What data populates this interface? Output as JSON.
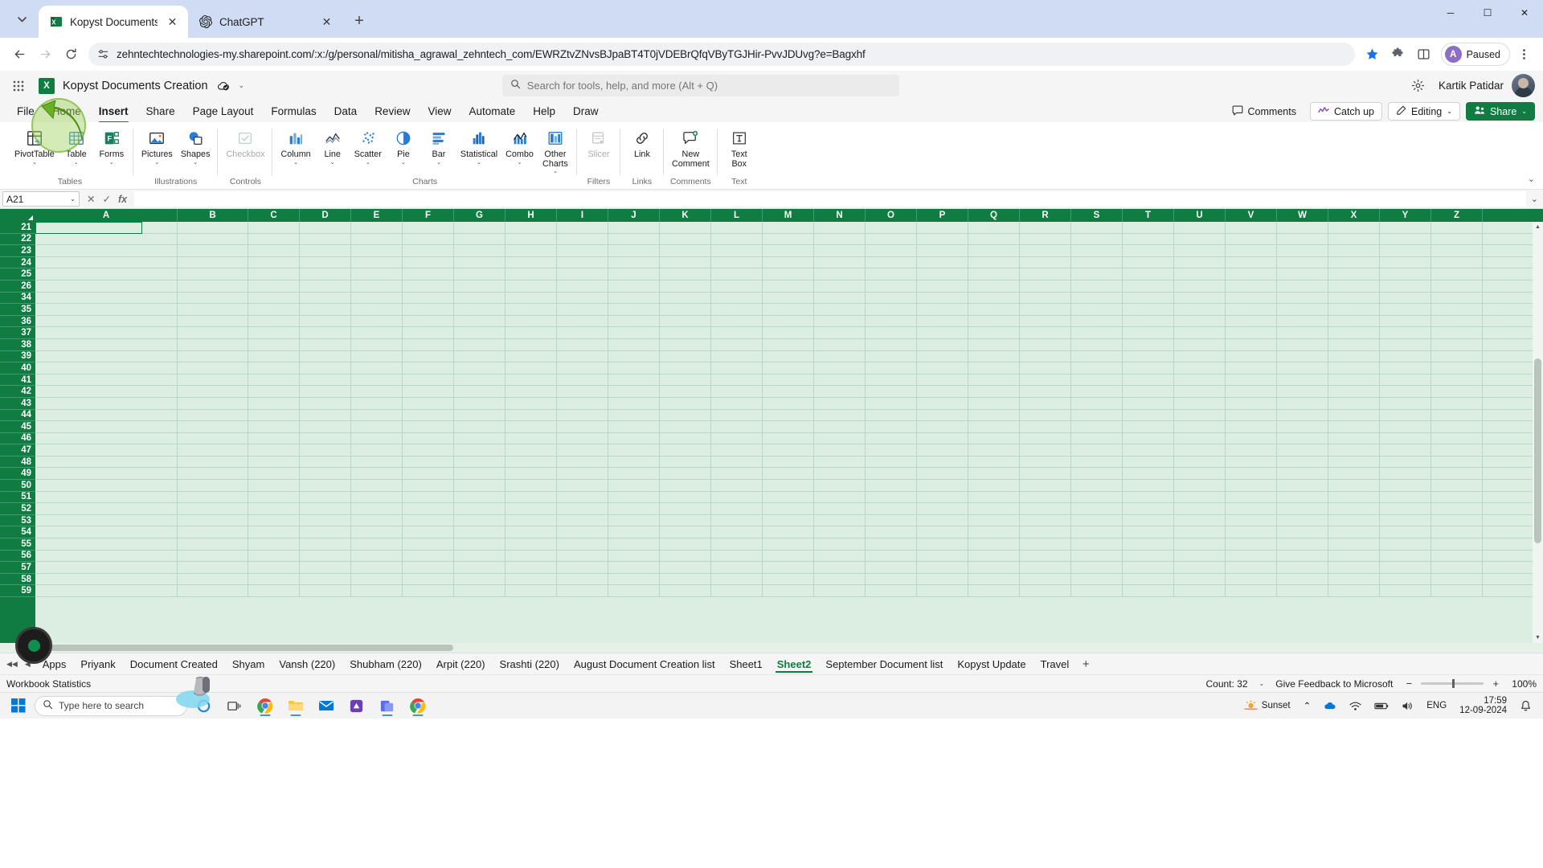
{
  "browser": {
    "tabs": [
      {
        "title": "Kopyst Documents Creation.xlsx",
        "favicon": "excel-icon",
        "active": true
      },
      {
        "title": "ChatGPT",
        "favicon": "chatgpt-icon",
        "active": false
      }
    ],
    "new_tab_label": "+",
    "tab_search_label": "⌄",
    "nav": {
      "back": "←",
      "forward": "→",
      "reload": "↻"
    },
    "url": "zehntechtechnologies-my.sharepoint.com/:x:/g/personal/mitisha_agrawal_zehntech_com/EWRZtvZNvsBJpaBT4T0jVDEBrQfqVByTGJHir-PvvJDUvg?e=Bagxhf",
    "site_info_icon": "tune-icon",
    "bookmark_icon": "star-filled-icon",
    "extensions_icon": "puzzle-icon",
    "split_icon": "split-screen-icon",
    "profile": {
      "initial": "A",
      "label": "Paused"
    },
    "menu_icon": "three-dots-vertical-icon",
    "window_controls": {
      "minimize": "─",
      "maximize": "☐",
      "close": "✕"
    }
  },
  "excel": {
    "waffle_icon": "app-launcher-icon",
    "logo_letter": "X",
    "document_title": "Kopyst Documents Creation",
    "autosave_icon": "autosave-cloud-icon",
    "title_chevron": "⌄",
    "search": {
      "placeholder": "Search for tools, help, and more (Alt + Q)",
      "icon": "search-icon"
    },
    "settings_icon": "gear-icon",
    "user_name": "Kartik Patidar",
    "avatar_icon": "user-avatar",
    "ribbon_tabs": [
      {
        "label": "File",
        "active": false
      },
      {
        "label": "Home",
        "active": false
      },
      {
        "label": "Insert",
        "active": true
      },
      {
        "label": "Share",
        "active": false
      },
      {
        "label": "Page Layout",
        "active": false
      },
      {
        "label": "Formulas",
        "active": false
      },
      {
        "label": "Data",
        "active": false
      },
      {
        "label": "Review",
        "active": false
      },
      {
        "label": "View",
        "active": false
      },
      {
        "label": "Automate",
        "active": false
      },
      {
        "label": "Help",
        "active": false
      },
      {
        "label": "Draw",
        "active": false
      }
    ],
    "ribbon_right": [
      {
        "label": "Comments",
        "icon": "comment-icon"
      },
      {
        "label": "Catch up",
        "icon": "catchup-icon"
      },
      {
        "label": "Editing",
        "icon": "pencil-icon",
        "chevron": "⌄",
        "bordered": true
      },
      {
        "label": "Share",
        "icon": "share-people-icon",
        "primary": true,
        "chevron": "⌄"
      }
    ],
    "ribbon_collapse_icon": "⌄",
    "ribbon_groups": [
      {
        "name": "Tables",
        "buttons": [
          {
            "label": "PivotTable",
            "icon": "pivot-table-icon",
            "chevron": "⌄",
            "disabled": false
          },
          {
            "label": "Table",
            "icon": "table-icon",
            "chevron": "⌄",
            "disabled": false
          },
          {
            "label": "Forms",
            "icon": "forms-icon",
            "chevron": "⌄",
            "disabled": false
          }
        ]
      },
      {
        "name": "Illustrations",
        "buttons": [
          {
            "label": "Pictures",
            "icon": "picture-icon",
            "chevron": "⌄",
            "disabled": false
          },
          {
            "label": "Shapes",
            "icon": "shapes-icon",
            "chevron": "⌄",
            "disabled": false
          }
        ]
      },
      {
        "name": "Controls",
        "buttons": [
          {
            "label": "Checkbox",
            "icon": "checkbox-icon",
            "chevron": "",
            "disabled": true
          }
        ]
      },
      {
        "name": "Charts",
        "buttons": [
          {
            "label": "Column",
            "icon": "column-chart-icon",
            "chevron": "⌄",
            "disabled": false
          },
          {
            "label": "Line",
            "icon": "line-chart-icon",
            "chevron": "⌄",
            "disabled": false
          },
          {
            "label": "Scatter",
            "icon": "scatter-chart-icon",
            "chevron": "⌄",
            "disabled": false
          },
          {
            "label": "Pie",
            "icon": "pie-chart-icon",
            "chevron": "⌄",
            "disabled": false
          },
          {
            "label": "Bar",
            "icon": "bar-chart-icon",
            "chevron": "⌄",
            "disabled": false
          },
          {
            "label": "Statistical",
            "icon": "statistical-chart-icon",
            "chevron": "⌄",
            "disabled": false
          },
          {
            "label": "Combo",
            "icon": "combo-chart-icon",
            "chevron": "⌄",
            "disabled": false
          },
          {
            "label": "Other\nCharts",
            "icon": "other-charts-icon",
            "chevron": "⌄",
            "disabled": false
          }
        ]
      },
      {
        "name": "Filters",
        "buttons": [
          {
            "label": "Slicer",
            "icon": "slicer-icon",
            "chevron": "",
            "disabled": true
          }
        ]
      },
      {
        "name": "Links",
        "buttons": [
          {
            "label": "Link",
            "icon": "link-icon",
            "chevron": "",
            "disabled": false
          }
        ]
      },
      {
        "name": "Comments",
        "buttons": [
          {
            "label": "New\nComment",
            "icon": "new-comment-icon",
            "chevron": "",
            "disabled": false
          }
        ]
      },
      {
        "name": "Text",
        "buttons": [
          {
            "label": "Text\nBox",
            "icon": "text-box-icon",
            "chevron": "",
            "disabled": false
          }
        ]
      }
    ],
    "formula_bar": {
      "name_box_value": "A21",
      "name_box_chevron": "⌄",
      "cancel_icon": "✕",
      "enter_icon": "✓",
      "function_icon": "fx",
      "formula_value": "",
      "expand_icon": "⌄"
    },
    "grid": {
      "columns": [
        "A",
        "B",
        "C",
        "D",
        "E",
        "F",
        "G",
        "H",
        "I",
        "J",
        "K",
        "L",
        "M",
        "N",
        "O",
        "P",
        "Q",
        "R",
        "S",
        "T",
        "U",
        "V",
        "W",
        "X",
        "Y",
        "Z"
      ],
      "rows": [
        21,
        22,
        23,
        24,
        25,
        26,
        34,
        35,
        36,
        37,
        38,
        39,
        40,
        41,
        42,
        43,
        44,
        45,
        46,
        47,
        48,
        49,
        50,
        51,
        52,
        53,
        54,
        55,
        56,
        57,
        58,
        59
      ],
      "active_cell": "A21",
      "header_bg": "#107c41",
      "cell_bg": "#dceee2",
      "gridline_color": "#b9d6c6"
    },
    "sheet_tabs": {
      "nav_first": "◀◀",
      "nav_prev": "◀",
      "tabs": [
        {
          "label": "Apps",
          "active": false
        },
        {
          "label": "Priyank",
          "active": false
        },
        {
          "label": "Document Created",
          "active": false
        },
        {
          "label": "Shyam",
          "active": false
        },
        {
          "label": "Vansh (220)",
          "active": false
        },
        {
          "label": "Shubham (220)",
          "active": false
        },
        {
          "label": "Arpit (220)",
          "active": false
        },
        {
          "label": "Srashti (220)",
          "active": false
        },
        {
          "label": "August Document Creation list",
          "active": false
        },
        {
          "label": "Sheet1",
          "active": false
        },
        {
          "label": "Sheet2",
          "active": true
        },
        {
          "label": "September Document list",
          "active": false
        },
        {
          "label": "Kopyst Update",
          "active": false
        },
        {
          "label": "Travel",
          "active": false
        }
      ],
      "add_sheet_label": "+"
    },
    "status_bar": {
      "left_label": "Workbook Statistics",
      "count_label": "Count: 32",
      "count_chevron": "⌄",
      "feedback_label": "Give Feedback to Microsoft",
      "zoom_out": "−",
      "zoom_level": "100%",
      "zoom_in": "+"
    }
  },
  "taskbar": {
    "start_icon": "windows-logo-icon",
    "search_placeholder": "Type here to search",
    "search_icon": "search-icon",
    "apps": [
      {
        "name": "cortana-icon",
        "running": false
      },
      {
        "name": "task-view-icon",
        "running": false
      },
      {
        "name": "chrome-icon",
        "running": true
      },
      {
        "name": "file-explorer-icon",
        "running": true
      },
      {
        "name": "mail-icon",
        "running": false
      },
      {
        "name": "store-icon",
        "running": false
      },
      {
        "name": "kopyst-icon",
        "running": true
      },
      {
        "name": "chrome-window-icon",
        "running": true
      }
    ],
    "tray": {
      "weather_icon": "sunset-icon",
      "weather_label": "Sunset",
      "show_hidden_icon": "⌃",
      "language": "ENG",
      "time": "17:59",
      "date": "12-09-2024",
      "notification_icon": "notification-bell-icon"
    }
  }
}
